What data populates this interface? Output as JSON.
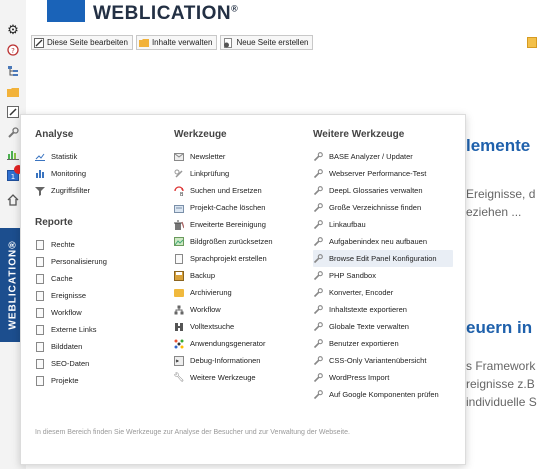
{
  "brand": {
    "name": "WEBLICATION",
    "mark": "®",
    "vertical": "WEBLICATION®"
  },
  "sidebar": {
    "icons": [
      "gear-icon",
      "help-icon",
      "tree-icon",
      "folder-icon",
      "edit-icon",
      "wrench-icon",
      "stats-icon",
      "calendar-icon",
      "home-icon"
    ]
  },
  "toolbar": {
    "edit_page": "Diese Seite bearbeiten",
    "manage_content": "Inhalte verwalten",
    "new_page": "Neue Seite erstellen"
  },
  "background": {
    "heading1": "lemente",
    "text1a": "Ereignisse, d",
    "text1b": "eziehen ...",
    "heading2": "euern in",
    "text2a": "s Framework",
    "text2b": "reignisse z.B",
    "text2c": "individuelle S"
  },
  "menu": {
    "analyse": {
      "title": "Analyse",
      "items": [
        "Statistik",
        "Monitoring",
        "Zugriffsfilter"
      ]
    },
    "reporte": {
      "title": "Reporte",
      "items": [
        "Rechte",
        "Personalisierung",
        "Cache",
        "Ereignisse",
        "Workflow",
        "Externe Links",
        "Bilddaten",
        "SEO-Daten",
        "Projekte"
      ]
    },
    "werkzeuge": {
      "title": "Werkzeuge",
      "items": [
        "Newsletter",
        "Linkprüfung",
        "Suchen und Ersetzen",
        "Projekt-Cache löschen",
        "Erweiterte Bereinigung",
        "Bildgrößen zurücksetzen",
        "Sprachprojekt erstellen",
        "Backup",
        "Archivierung",
        "Workflow",
        "Volltextsuche",
        "Anwendungsgenerator",
        "Debug-Informationen",
        "Weitere Werkzeuge"
      ]
    },
    "weitere": {
      "title": "Weitere Werkzeuge",
      "items": [
        "BASE Analyzer / Updater",
        "Webserver Performance-Test",
        "DeepL Glossaries verwalten",
        "Große Verzeichnisse finden",
        "Linkaufbau",
        "Aufgabenindex neu aufbauen",
        "Browse Edit Panel Konfiguration",
        "PHP Sandbox",
        "Konverter, Encoder",
        "Inhaltstexte exportieren",
        "Globale Texte verwalten",
        "Benutzer exportieren",
        "CSS-Only Variantenübersicht",
        "WordPress Import",
        "Auf Google Komponenten prüfen"
      ],
      "active": "Browse Edit Panel Konfiguration"
    },
    "footer": "In diesem Bereich finden Sie Werkzeuge zur Analyse der Besucher und zur Verwaltung der Webseite."
  }
}
